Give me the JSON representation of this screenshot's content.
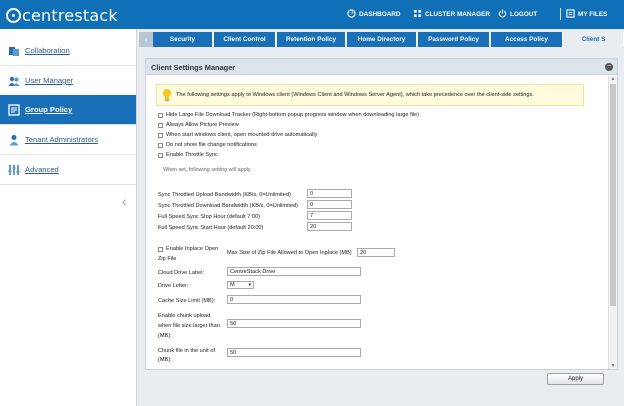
{
  "app": {
    "logo_text": "centrestack"
  },
  "topnav": {
    "dashboard": "DASHBOARD",
    "cluster_manager": "CLUSTER MANAGER",
    "logout": "LOGOUT",
    "my_files": "MY FILES"
  },
  "sidebar": {
    "items": [
      {
        "label": "Collaboration",
        "icon": "collaboration-icon"
      },
      {
        "label": "User Manager",
        "icon": "users-icon"
      },
      {
        "label": "Group Policy",
        "icon": "group-policy-icon",
        "active": true
      },
      {
        "label": "Tenant Administrators",
        "icon": "admin-icon"
      },
      {
        "label": "Advanced",
        "icon": "advanced-icon"
      }
    ]
  },
  "tabs": [
    "Security",
    "Client Control",
    "Retention Policy",
    "Home Directory",
    "Password Policy",
    "Access Policy",
    "Client S"
  ],
  "panel": {
    "title": "Client Settings Manager",
    "notice": "The following settings apply to Windows client (Windows Client and Windows Server Agent), which take precedence over the client-side settings."
  },
  "checkboxes": [
    "Hide Large File Download Tracker (Right-bottom popup progress window when downloading large file)",
    "Always Allow Picture Preview",
    "When start windows client, open mounted drive automatically",
    "Do not show file change notifications",
    "Enable Throttle Sync"
  ],
  "throttle_hint": "When set, following setting will apply.",
  "throttle_fields": [
    {
      "label": "Sync Throttled Upload Bandwidth (KB/s, 0=Unlimited)",
      "value": "0"
    },
    {
      "label": "Sync Throttled Download Bandwidth (KB/s, 0=Unlimited)",
      "value": "0"
    },
    {
      "label": "Full Speed Sync Stop Hour (default 7:00)",
      "value": "7"
    },
    {
      "label": "Full Speed Sync Start Hour (default 20:00)",
      "value": "20"
    }
  ],
  "inplace": {
    "checkbox_label_1": "Enable Inplace Open",
    "checkbox_label_2": "Zip File",
    "max_label": "Max Size of Zip File Allowed to Open Inplace (MB)",
    "max_value": "20"
  },
  "drive": {
    "label_label": "Cloud Drive Label:",
    "label_value": "CentreStack Drive",
    "letter_label": "Drive Letter:",
    "letter_value": "M",
    "cache_label": "Cache Size Limit (MB):",
    "cache_value": "0",
    "chunk_label_1": "Enable chunk upload",
    "chunk_label_2": "when file size larger than",
    "chunk_label_3": "(MB):",
    "chunk_value": "50",
    "unit_label_1": "Chunk file in the unit of",
    "unit_label_2": "(MB):",
    "unit_value": "50"
  },
  "footer": {
    "apply": "Apply"
  },
  "colors": {
    "brand": "#0f6fb7",
    "tab": "#1a70b8",
    "notice_bg": "#fffbdc"
  }
}
